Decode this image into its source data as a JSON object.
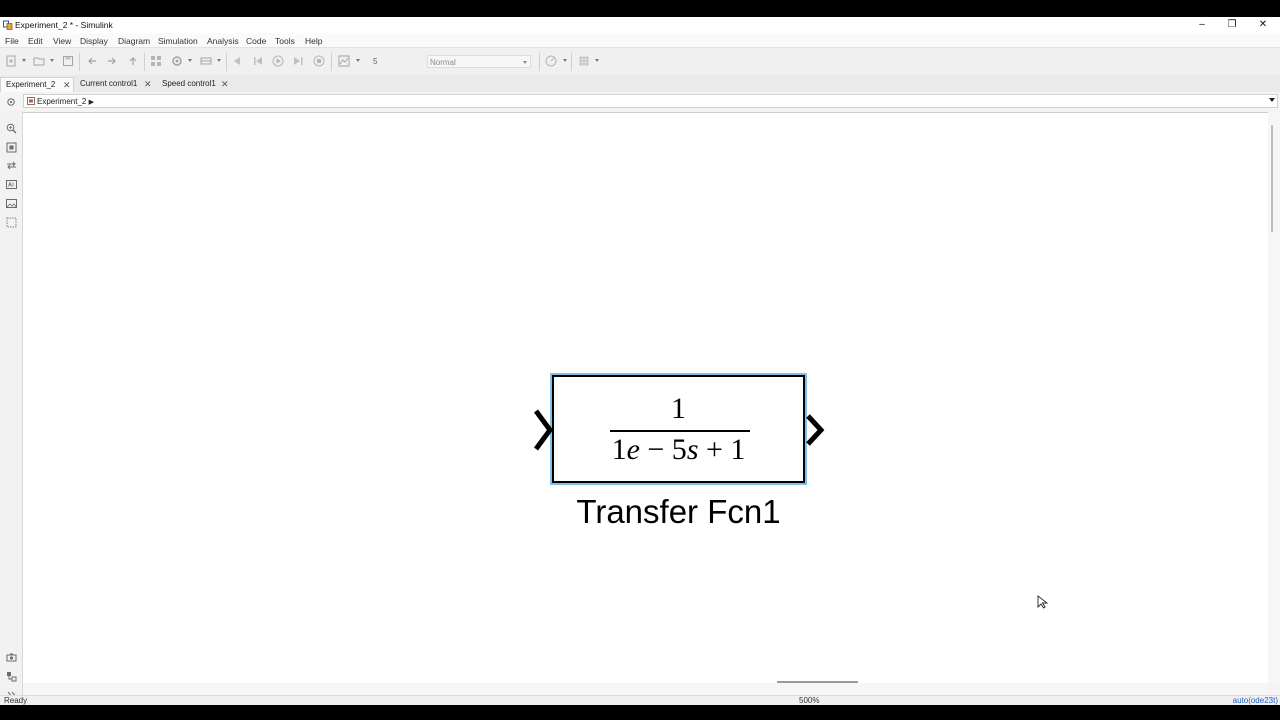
{
  "window": {
    "title": "Experiment_2 * - Simulink",
    "controls": {
      "minimize": "–",
      "restore": "❐",
      "close": "✕"
    }
  },
  "menu": [
    "File",
    "Edit",
    "View",
    "Display",
    "Diagram",
    "Simulation",
    "Analysis",
    "Code",
    "Tools",
    "Help"
  ],
  "toolbar": {
    "stop_time": "5",
    "sim_mode": "Normal"
  },
  "tabs": [
    {
      "label": "Experiment_2",
      "active": true,
      "close": "✕"
    },
    {
      "label": "Current control1",
      "active": false,
      "close": "✕"
    },
    {
      "label": "Speed control1",
      "active": false,
      "close": "✕"
    }
  ],
  "address": {
    "crumb": "Experiment_2",
    "arrow": "▶"
  },
  "block": {
    "numerator": "1",
    "denominator": {
      "coef": "1",
      "e": "e",
      "minus": " − 5",
      "s": "s",
      "plus": " + 1"
    },
    "name": "Transfer Fcn1"
  },
  "status": {
    "left": "Ready",
    "zoom": "500%",
    "solver": "auto(ode23t)"
  },
  "colors": {
    "selection": "#7ec0ea",
    "solver_link": "#1f5fbf",
    "block_border": "#000000"
  }
}
